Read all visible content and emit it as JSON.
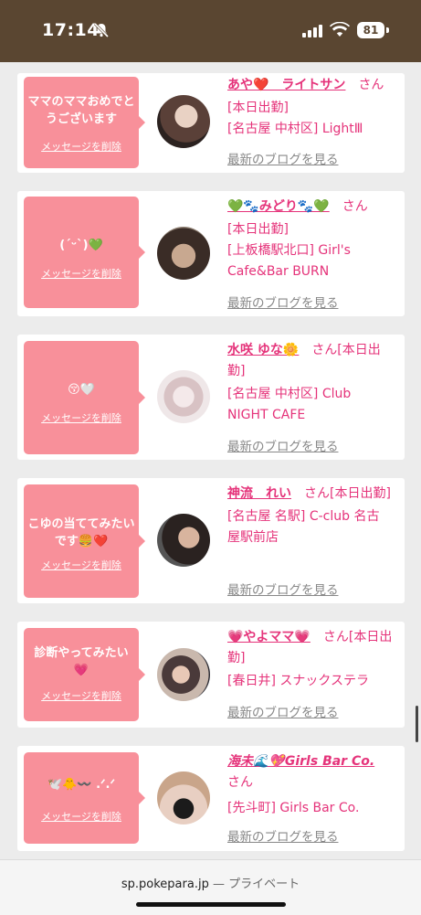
{
  "status": {
    "time": "17:14",
    "battery": "81"
  },
  "cards": [
    {
      "message": "ママのママおめでとうございます",
      "delete": "メッセージを削除",
      "name": "あや❤️　ライトサン",
      "suffix": "さん",
      "lines": [
        "[本日出勤]",
        "[名古屋 中村区] LightⅢ"
      ],
      "blog": "最新のブログを見る"
    },
    {
      "message": "(ˊᵕˋ)💚",
      "delete": "メッセージを削除",
      "name": "💚🐾みどり🐾💚",
      "suffix": "さん",
      "lines": [
        "[本日出勤]",
        "[上板橋駅北口] Girl's",
        "Cafe&Bar BURN"
      ],
      "blog": "最新のブログを見る"
    },
    {
      "message": "😚🤍",
      "delete": "メッセージを削除",
      "name": "水咲 ゆな🌼",
      "suffix": "さん[本日出勤]",
      "lines": [
        "[名古屋 中村区] Club",
        "NIGHT CAFE"
      ],
      "blog": "最新のブログを見る"
    },
    {
      "message": "こゆの当ててみたいです🍔❤️",
      "delete": "メッセージを削除",
      "name": "神流　れい",
      "suffix": "さん[本日出勤]",
      "lines": [
        "[名古屋 名駅] C-club 名古",
        "屋駅前店"
      ],
      "blog": "最新のブログを見る"
    },
    {
      "message": "診断やってみたい💗",
      "delete": "メッセージを削除",
      "name": "💗やよママ💗",
      "suffix": "さん[本日出勤]",
      "lines": [
        "[春日井] スナックステラ"
      ],
      "blog": "最新のブログを見る"
    },
    {
      "message": "🕊️🐥〰️ .ᐟ.ᐟ",
      "delete": "メッセージを削除",
      "name": "海未🌊💖Girls Bar Co.",
      "suffix": "さん",
      "lines": [
        "[先斗町] Girls Bar Co."
      ],
      "blog": "最新のブログを見る"
    }
  ],
  "browser": {
    "url": "sp.pokepara.jp",
    "mode": "— プライベート"
  },
  "colors": {
    "accent": "#e5337a",
    "bubble": "#f8909a",
    "statusbar": "#5a4631"
  }
}
